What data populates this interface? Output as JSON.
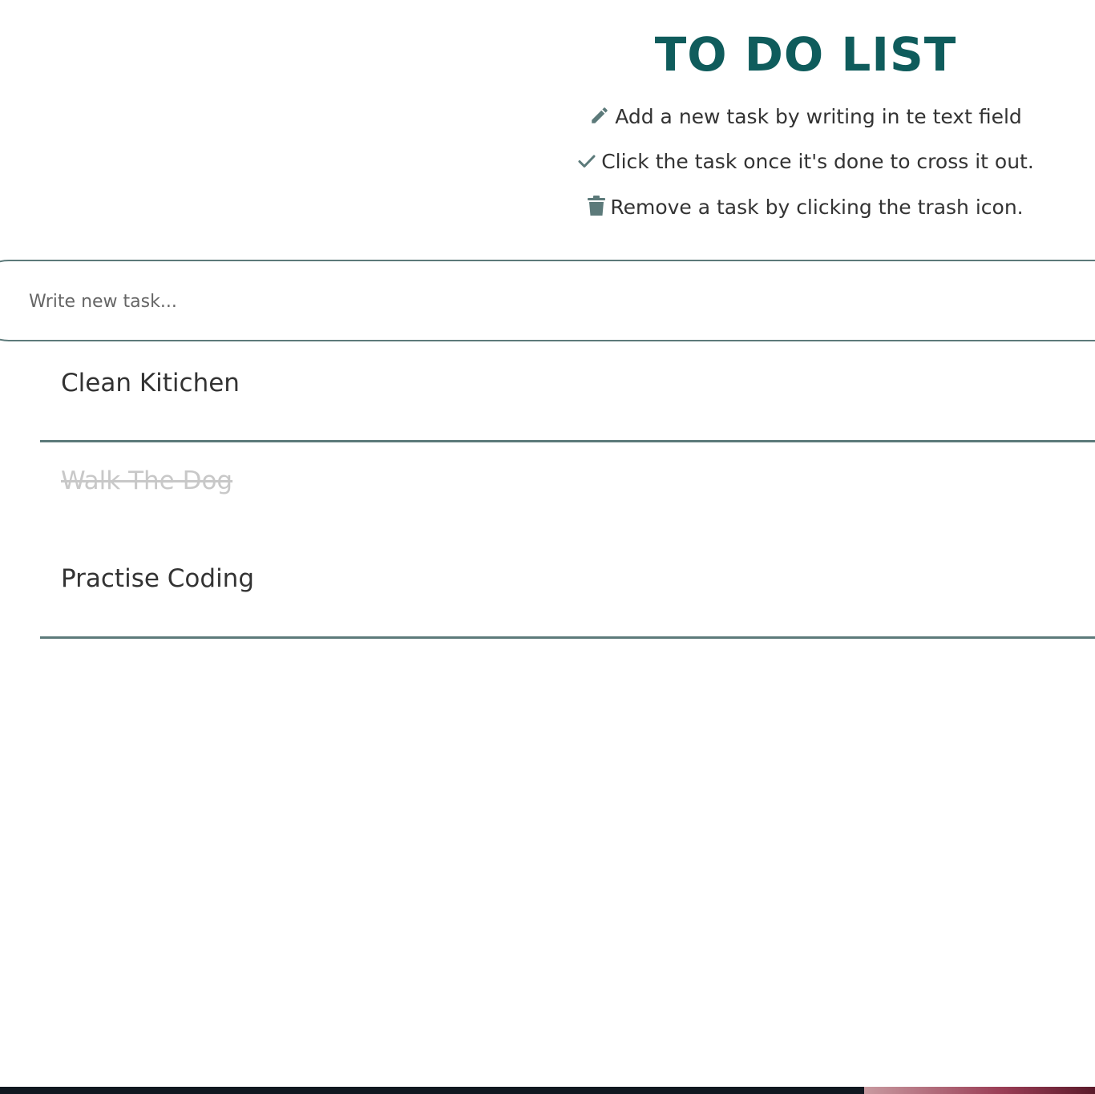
{
  "header": {
    "title": "TO DO LIST"
  },
  "instructions": [
    {
      "icon": "pencil-icon",
      "text": "Add a new task by writing in te text field"
    },
    {
      "icon": "check-icon",
      "text": "Click the task once it's done to cross it out."
    },
    {
      "icon": "trash-icon",
      "text": "Remove a task by clicking the trash icon."
    }
  ],
  "input": {
    "placeholder": "Write new task...",
    "value": ""
  },
  "tasks": [
    {
      "text": "Clean Kitichen",
      "done": false
    },
    {
      "text": "Walk The Dog",
      "done": true
    },
    {
      "text": "Practise Coding",
      "done": false
    }
  ],
  "colors": {
    "accent": "#0f5c5c",
    "border": "#5c7a7a",
    "text": "#333333",
    "done_text": "#c8c8c8"
  }
}
